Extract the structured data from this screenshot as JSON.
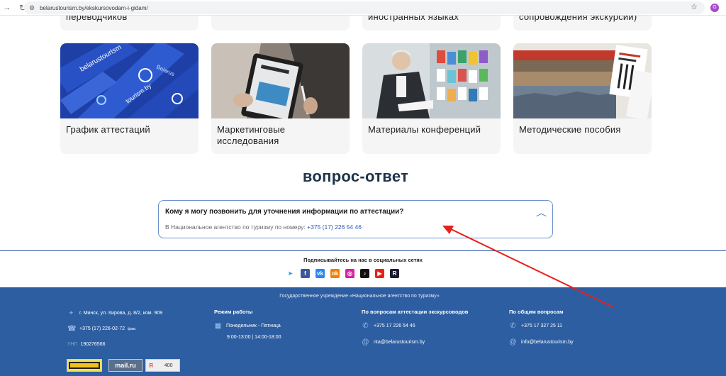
{
  "browser": {
    "url": "belarustourism.by/ekskursovodam-i-gidam/",
    "profile_initial": "G"
  },
  "top_cards": [
    {
      "title": "переводчиков"
    },
    {
      "title": ""
    },
    {
      "title": "иностранных языках"
    },
    {
      "title": "сопровождения экскурсий)"
    }
  ],
  "cards": [
    {
      "title": "График аттестаций"
    },
    {
      "title": "Маркетинговые исследования"
    },
    {
      "title": "Материалы конференций"
    },
    {
      "title": "Методические пособия"
    }
  ],
  "faq": {
    "heading": "вопрос-ответ",
    "question": "Кому я могу позвонить для уточнения информации по аттестации?",
    "answer_prefix": "В Национальное агентство по туризму по номеру:",
    "answer_phone": "+375 (17) 226 54 46"
  },
  "social": {
    "title": "Подписывайтесь на нас в социальных сетях",
    "items": [
      {
        "name": "telegram-icon",
        "glyph": "➤",
        "color": "#ffffff",
        "fg": "#2a9fd6"
      },
      {
        "name": "facebook-icon",
        "glyph": "f",
        "color": "#3b5998",
        "fg": "#ffffff"
      },
      {
        "name": "vk-icon",
        "glyph": "vk",
        "color": "#2787f5",
        "fg": "#ffffff"
      },
      {
        "name": "odnoklassniki-icon",
        "glyph": "ok",
        "color": "#ee8208",
        "fg": "#ffffff"
      },
      {
        "name": "instagram-icon",
        "glyph": "◎",
        "color": "#d6249f",
        "fg": "#ffffff"
      },
      {
        "name": "tiktok-icon",
        "glyph": "♪",
        "color": "#111111",
        "fg": "#ffffff"
      },
      {
        "name": "youtube-icon",
        "glyph": "▶",
        "color": "#e62117",
        "fg": "#ffffff"
      },
      {
        "name": "rutube-icon",
        "glyph": "R",
        "color": "#1c1c2e",
        "fg": "#ffffff"
      }
    ]
  },
  "footer": {
    "org": "Государственное учреждение «Национальное агентство по туризму»",
    "address": "г. Минск, ул. Кирова, д. 8/2, ком. 909",
    "fax_phone": "+375 (17) 226-02-72",
    "fax_label": "факс",
    "unp_label": "УНП",
    "unp_value": "190276566",
    "schedule_title": "Режим работы",
    "schedule_days": "Понедельник - Пятница",
    "schedule_hours": "9:00-13:00 | 14:00-18:00",
    "cert_title": "По вопросам аттестации экскурсоводов",
    "cert_phone": "+375 17 226 54 46",
    "cert_email": "nta@belarustourism.by",
    "general_title": "По общим вопросам",
    "general_phone": "+375 17 327 25 11",
    "general_email": "info@belarustourism.by",
    "counter_mailru": "mail.ru",
    "counter_yandex": "Я",
    "counter_yandex_value": "400"
  },
  "colors": {
    "footer_bg": "#2c5ea1",
    "accent": "#2d55b4",
    "annotation_arrow": "#e8201c"
  }
}
